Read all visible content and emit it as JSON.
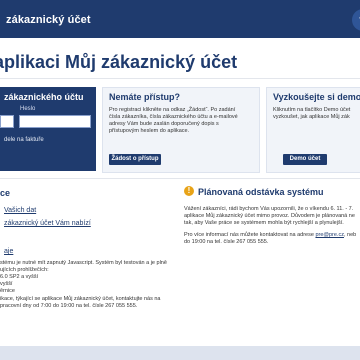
{
  "header": {
    "title": "zákaznický účet",
    "help": "?"
  },
  "headline": "aplikaci Můj zákaznický účet",
  "login": {
    "title": "zákaznického účtu",
    "password_label": "Heslo",
    "forgot": "dele na faktuře"
  },
  "no_access": {
    "title": "Nemáte přístup?",
    "lines": [
      "Pro registraci klikněte na odkaz „Žádost“. Po zadání",
      "čísla zákazníka, čísla zákaznického účtu a e-mailové",
      "adresy Vám bude zaslán doporučený dopis s",
      "přístupovým heslem do aplikace."
    ],
    "button": "Žádost o přístup"
  },
  "demo": {
    "title": "Vyzkoušejte si demo ú",
    "lines": [
      "Kliknutím na tlačítko Demo účet",
      "vyzkoušet, jak aplikace Můj zák"
    ],
    "button": "Demo účet"
  },
  "left_section": {
    "title": "ce",
    "links": [
      "Vašich dat",
      "zákaznický účet Vám nabízí"
    ],
    "link3": "aje",
    "lines": [
      "stému je nutné mít zapnutý Javascript. Systém byl testován a je plně",
      "ujících prohlížečích:",
      "6.0 SP2 a vyšší",
      "vyšší",
      "ěrnice",
      "",
      "ikace, týkající se aplikace Můj zákaznický účet, kontaktujte nás na",
      "pracovní dny od 7:00 do 19:00 na tel. čísle 267 055 555."
    ]
  },
  "right_section": {
    "title": "Plánovaná odstávka systému",
    "icon": "warning-icon",
    "lines": [
      "Vážení zákazníci, rádi bychom Vás upozornili, že o víkendu 6. 11. - 7.",
      "aplikace Můj zákaznický účet mimo provoz. Důvodem je plánovaná ne",
      "tak, aby Vaše práce se systémem mohla být rychlejší a plynulejší.",
      "",
      "Pro více informací nás můžete kontaktovat na adrese",
      "do 19:00 na tel. čísle 267 055 555."
    ],
    "email": "pre@pre.cz",
    "email_suffix": ", neb"
  },
  "colors": {
    "brand": "#1f3b6e",
    "warning": "#e8a317"
  }
}
